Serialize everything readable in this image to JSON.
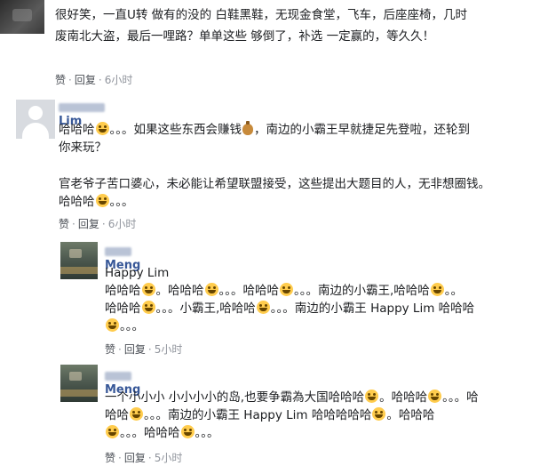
{
  "comments": [
    {
      "lines": [
        "很好笑，一直U转 做有的没的 白鞋黑鞋，无现金食堂，飞车，后座座椅，几时",
        "废南北大盗，最后一哩路？单单这些 够倒了，补选 一定赢的，等久久！"
      ],
      "like_label": "赞",
      "reply_label": "回复",
      "time": "6小时"
    },
    {
      "author_visible": "Lim",
      "lines": [
        [
          "哈哈哈",
          "emoji",
          "。。。如果这些东西会赚钱",
          "moneybag",
          "，南边的小霸王早就捷足先登啦，还轮到"
        ],
        [
          "你来玩？"
        ],
        [],
        [
          "官老爷子苦口婆心，未必能让希望联盟接受，这些提出大题目的人，无非想圈钱。"
        ],
        [
          "哈哈哈",
          "emoji",
          "。。。"
        ]
      ],
      "like_label": "赞",
      "reply_label": "回复",
      "time": "6小时"
    },
    {
      "author_visible": "Meng",
      "lines": [
        [
          "Happy Lim"
        ],
        [
          "哈哈哈",
          "emoji",
          "。哈哈哈",
          "emoji",
          "。。。哈哈哈",
          "emoji",
          "。。。南边的小霸王,哈哈哈",
          "emoji",
          "。。"
        ],
        [
          "哈哈哈",
          "emoji",
          "。。。小霸王,哈哈哈",
          "emoji",
          "。。。南边的小霸王 Happy Lim 哈哈哈"
        ],
        [
          "emoji",
          "。。。"
        ]
      ],
      "like_label": "赞",
      "reply_label": "回复",
      "time": "5小时"
    },
    {
      "author_visible": "Meng",
      "lines": [
        [
          "一个小小小 小小小小的岛,也要争霸為大国哈哈哈",
          "emoji",
          "。哈哈哈",
          "emoji",
          "。。。哈"
        ],
        [
          "哈哈",
          "emoji",
          "。。。南边的小霸王 Happy Lim 哈哈哈哈哈",
          "emoji",
          "。哈哈哈"
        ],
        [
          "emoji",
          "。。。哈哈哈",
          "emoji",
          "。。。"
        ]
      ],
      "like_label": "赞",
      "reply_label": "回复",
      "time": "5小时"
    }
  ],
  "icons": {
    "laugh": "grinning-face-with-smiling-eyes-emoji",
    "money": "money-bag-emoji"
  },
  "colors": {
    "name": "#385898",
    "meta": "#90949c",
    "text": "#1c1e21"
  }
}
